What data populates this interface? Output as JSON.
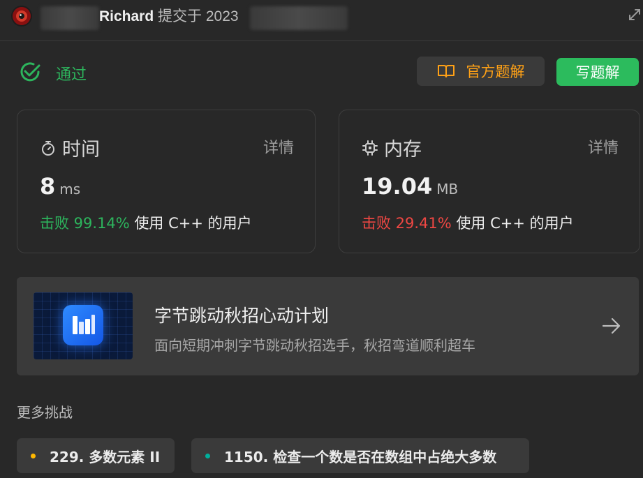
{
  "header": {
    "username": "Richard",
    "submitted_label": "提交于 2023"
  },
  "status": {
    "label": "通过",
    "color": "#2db55d"
  },
  "actions": {
    "official_solution": "官方题解",
    "write_solution": "写题解"
  },
  "stats": {
    "time": {
      "title": "时间",
      "detail": "详情",
      "value": "8",
      "unit": "ms",
      "beat_label": "击败 99.14%",
      "beat_suffix": "使用 C++ 的用户",
      "beat_color": "#2db55d"
    },
    "memory": {
      "title": "内存",
      "detail": "详情",
      "value": "19.04",
      "unit": "MB",
      "beat_label": "击败 29.41%",
      "beat_suffix": "使用 C++ 的用户",
      "beat_color": "#ef4743"
    }
  },
  "promo": {
    "title": "字节跳动秋招心动计划",
    "subtitle": "面向短期冲刺字节跳动秋招选手，秋招弯道顺利超车"
  },
  "more": {
    "title": "更多挑战",
    "items": [
      {
        "label": "229. 多数元素 II",
        "dot_color": "#ffb800"
      },
      {
        "label": "1150. 检查一个数是否在数组中占绝大多数",
        "dot_color": "#00af9b"
      }
    ]
  },
  "icons": {
    "status": "check-circle-icon",
    "official": "book-open-icon",
    "time": "stopwatch-icon",
    "memory": "chip-icon",
    "promo_arrow": "arrow-right-icon",
    "expand": "expand-icon"
  }
}
